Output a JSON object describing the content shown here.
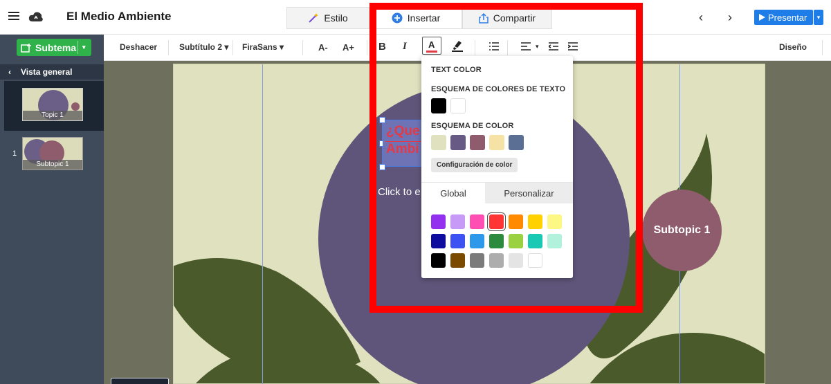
{
  "app": {
    "title": "El Medio Ambiente"
  },
  "toolbar": {
    "estilo_label": "Estilo",
    "insertar_label": "Insertar",
    "compartir_label": "Compartir",
    "present_label": "Presentar"
  },
  "format": {
    "deshacer": "Deshacer",
    "style_select": "Subtítulo 2",
    "font_select": "FiraSans",
    "decrease": "A-",
    "increase": "A+",
    "bold": "B",
    "italic": "I",
    "color": "A",
    "design": "Diseño"
  },
  "left": {
    "subtema_label": "Subtema",
    "overview_label": "Vista general",
    "thumbs": [
      {
        "label": "Topic 1"
      },
      {
        "label": "Subtopic 1",
        "number": "1"
      }
    ]
  },
  "slide": {
    "title_line1": "¿Que",
    "title_line2": "Ambi",
    "click_text": "Click to e",
    "subtopic_label": "Subtopic 1"
  },
  "color_menu": {
    "header": "TEXT COLOR",
    "text_scheme_label": "ESQUEMA DE COLORES DE TEXTO",
    "text_scheme": [
      "#000000",
      "#ffffff"
    ],
    "scheme_label": "ESQUEMA DE COLOR",
    "scheme": [
      "#dfe1bf",
      "#675b85",
      "#8e5c6c",
      "#f6e2a4",
      "#5b6e94"
    ],
    "config_label": "Configuración de color",
    "tabs": [
      "Global",
      "Personalizar"
    ],
    "palette": [
      [
        "#9330f0",
        "#c69af6",
        "#ff4fb2",
        "#ff3535",
        "#ff8a00",
        "#ffd100",
        "#fdf883"
      ],
      [
        "#0d0c9e",
        "#3c52f2",
        "#2e99ea",
        "#2b8a3e",
        "#99d141",
        "#19c9b4",
        "#b2f2dc"
      ],
      [
        "#000000",
        "#7a4a00",
        "#7b7b7b",
        "#adadad",
        "#e4e4e4",
        "#ffffff",
        null
      ]
    ],
    "selected": "#ff3535"
  },
  "colors": {
    "accent_blue": "#1f7de8",
    "subtema_green": "#2fb24a",
    "highlight_red": "#ff0000"
  }
}
